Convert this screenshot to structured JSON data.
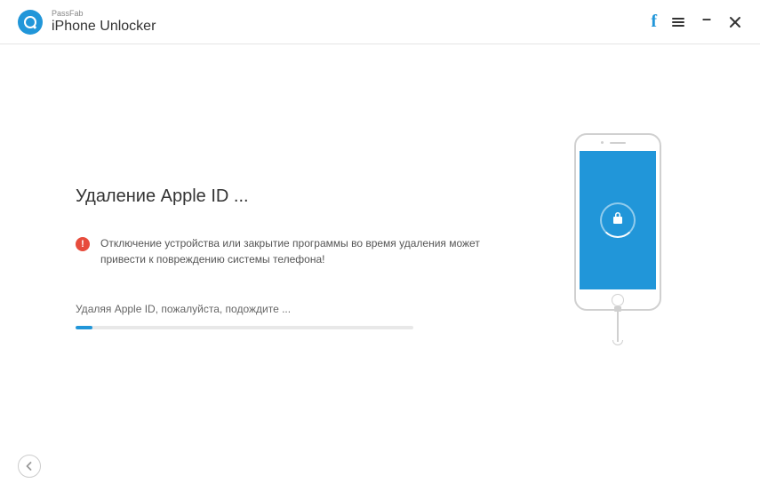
{
  "header": {
    "brand_small": "PassFab",
    "brand_main": "iPhone Unlocker"
  },
  "main": {
    "title": "Удаление Apple ID ...",
    "warning": "Отключение устройства или закрытие программы во время удаления может привести к повреждению системы телефона!",
    "progress_label": "Удаляя Apple ID, пожалуйста, подождите ...",
    "progress_percent": 5
  },
  "colors": {
    "accent": "#2196d9",
    "warning": "#e74c3c"
  }
}
